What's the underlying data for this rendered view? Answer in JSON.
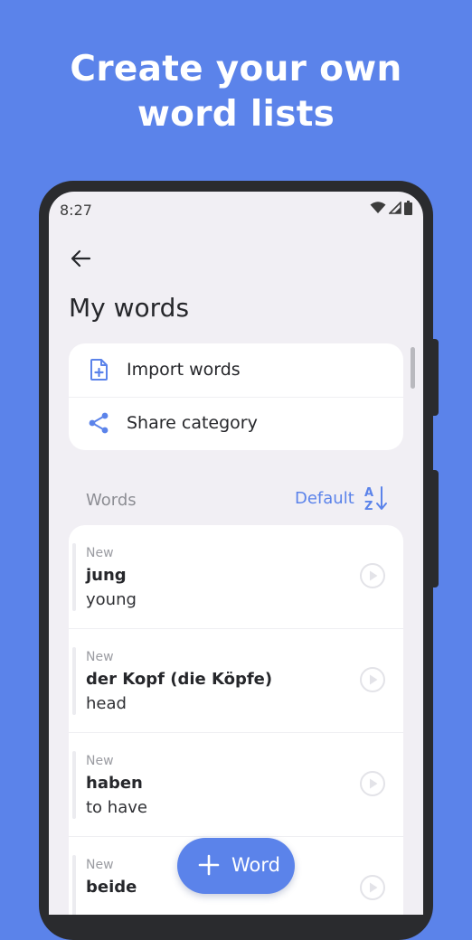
{
  "promo": {
    "line1": "Create your own",
    "line2": "word lists"
  },
  "status_bar": {
    "time": "8:27",
    "icons": [
      "wifi-icon",
      "signal-icon",
      "battery-icon"
    ]
  },
  "header": {
    "back_icon": "arrow-back-icon",
    "title": "My words"
  },
  "actions": [
    {
      "label": "Import words",
      "icon": "file-add-icon"
    },
    {
      "label": "Share category",
      "icon": "share-icon"
    }
  ],
  "words_section": {
    "label": "Words",
    "sort_label": "Default",
    "sort_icon": "sort-az-icon"
  },
  "words": [
    {
      "status": "New",
      "term": "jung",
      "translation": "young"
    },
    {
      "status": "New",
      "term": "der Kopf (die Köpfe)",
      "translation": "head"
    },
    {
      "status": "New",
      "term": "haben",
      "translation": "to have"
    },
    {
      "status": "New",
      "term": "beide",
      "translation": ""
    }
  ],
  "fab": {
    "label": "Word",
    "icon": "plus-icon"
  },
  "colors": {
    "background": "#5b83ea",
    "accent": "#5b83ea",
    "screen": "#f1eff4",
    "card": "#ffffff"
  }
}
